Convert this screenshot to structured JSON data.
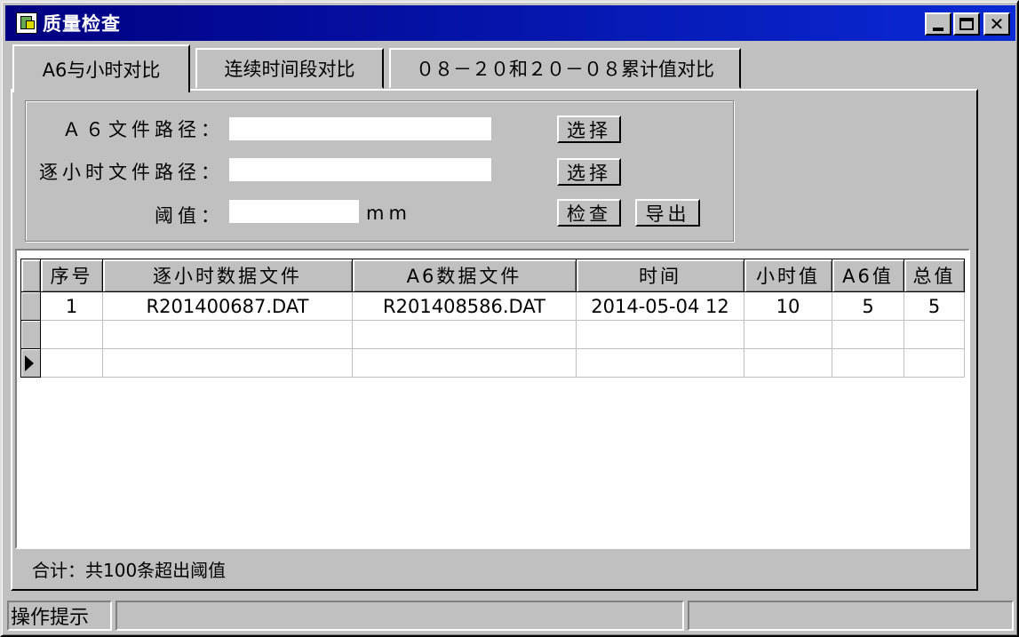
{
  "window": {
    "title": "质量检查"
  },
  "tabs": [
    {
      "label": "A6与小时对比"
    },
    {
      "label": "连续时间段对比"
    },
    {
      "label": "０８－２０和２０－０８累计值对比"
    }
  ],
  "form": {
    "a6_path_label": "Ａ６文件路径：",
    "a6_path_value": "",
    "hourly_path_label": "逐小时文件路径：",
    "hourly_path_value": "",
    "threshold_label": "阈值：",
    "threshold_value": "",
    "threshold_unit": "mm",
    "select_a6_label": "选择",
    "select_hourly_label": "选择",
    "check_label": "检查",
    "export_label": "导出"
  },
  "grid": {
    "columns": [
      "序号",
      "逐小时数据文件",
      "A6数据文件",
      "时间",
      "小时值",
      "A6值",
      "总值"
    ],
    "rows": [
      [
        "1",
        "R201400687.DAT",
        "R201408586.DAT",
        "2014-05-04 12",
        "10",
        "5",
        "5"
      ],
      [
        "",
        "",
        "",
        "",
        "",
        "",
        ""
      ],
      [
        "",
        "",
        "",
        "",
        "",
        "",
        ""
      ]
    ]
  },
  "summary": "合计：共100条超出阈值",
  "status": {
    "hint": "操作提示",
    "panel2": "",
    "panel3": ""
  }
}
